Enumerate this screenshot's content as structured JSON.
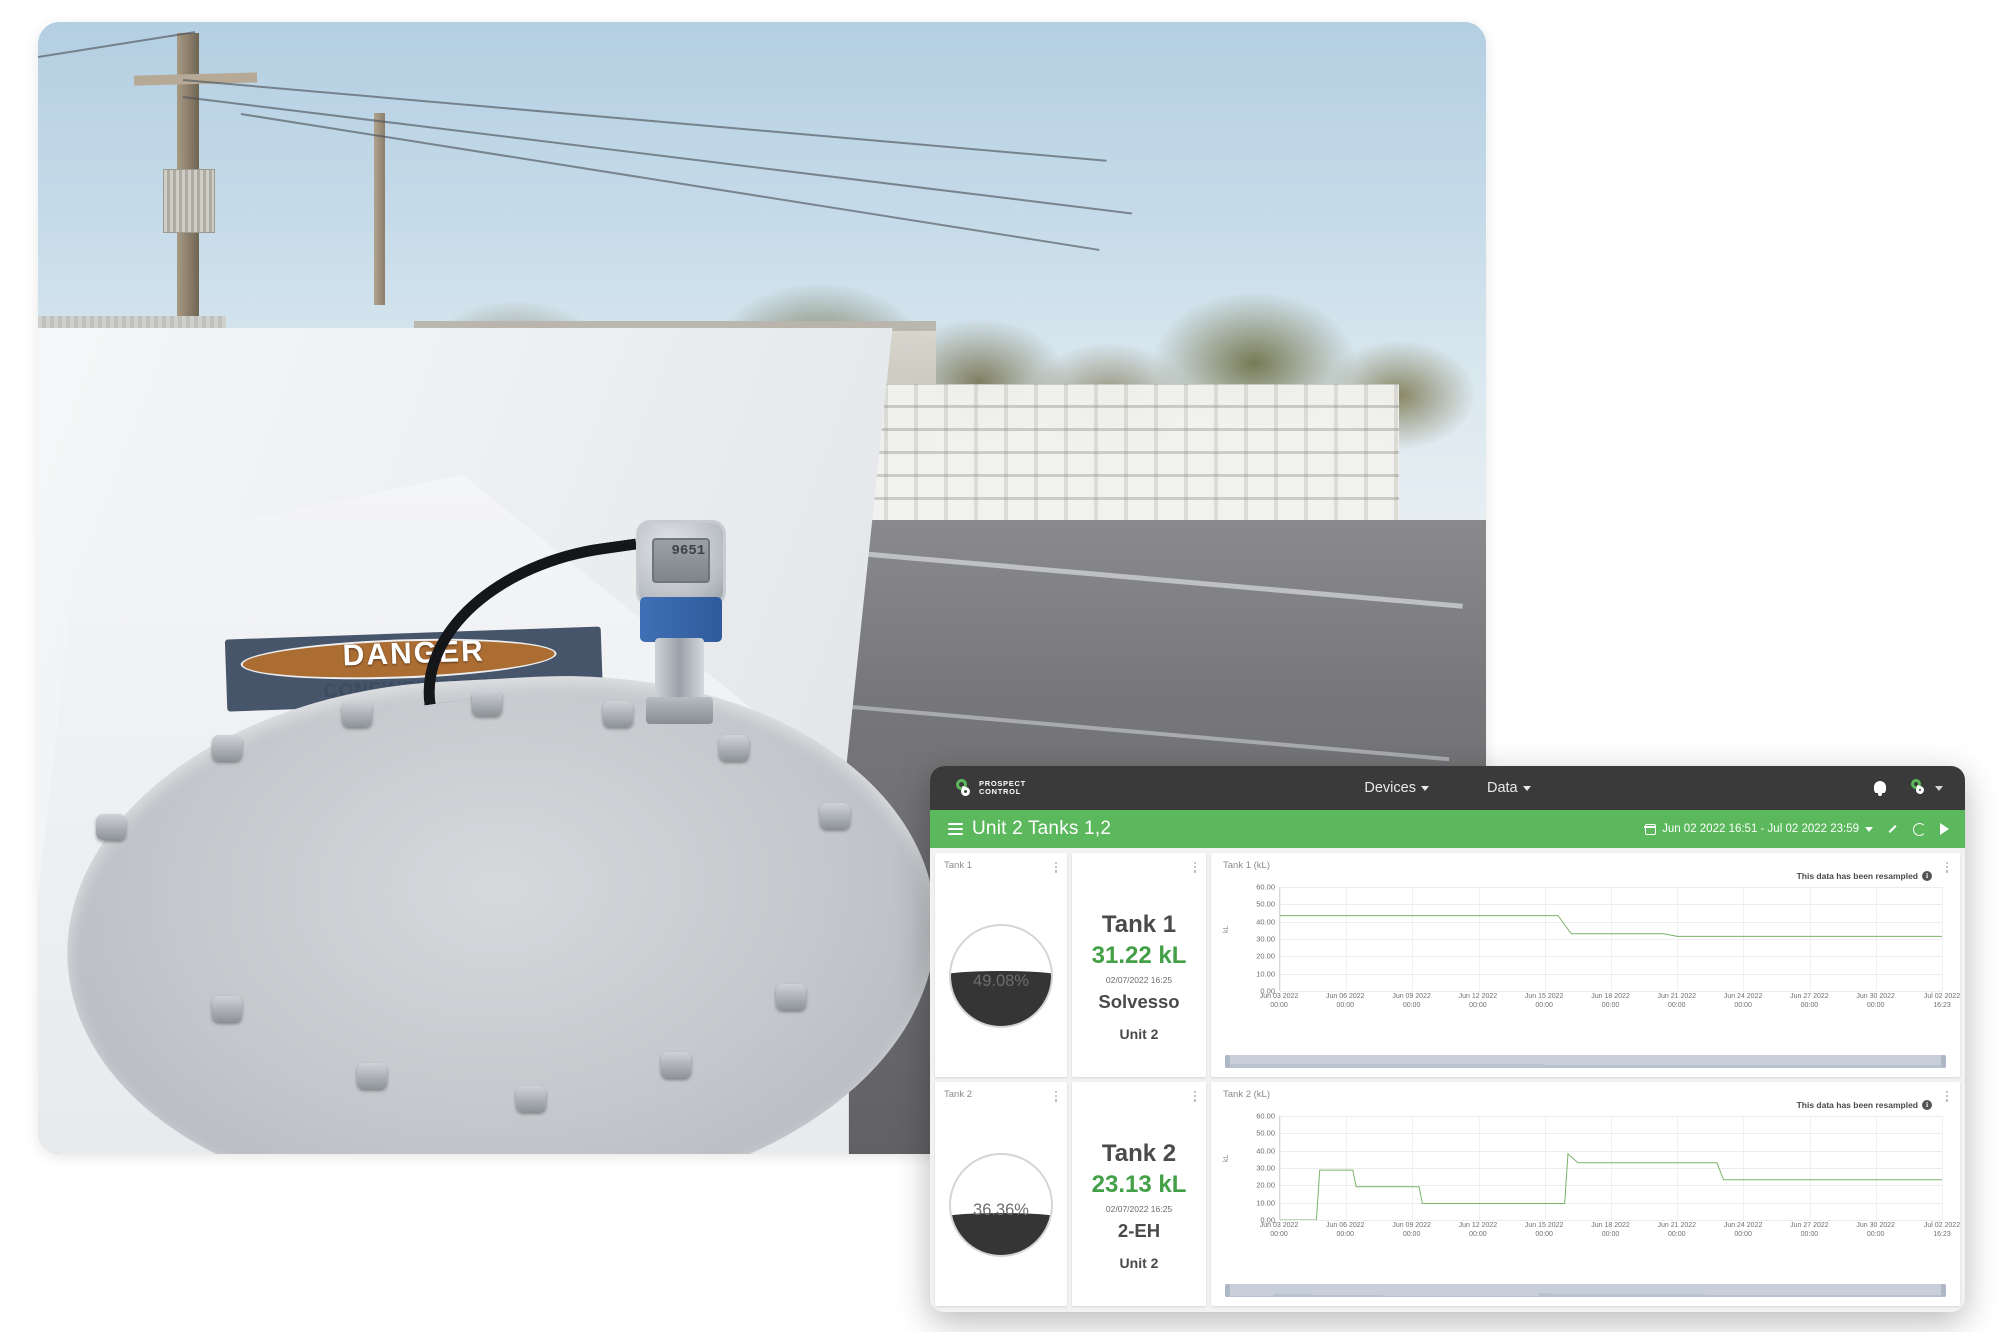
{
  "photo": {
    "alt": "Rooftop of a white road tanker with level transmitter, industrial yard with IBC totes behind",
    "decal_main": "DANGER",
    "decal_sub": "CONFINED SPACE",
    "sensor_display": "9651"
  },
  "nav": {
    "logo_line1": "PROSPECT",
    "logo_line2": "CONTROL",
    "items": [
      {
        "label": "Devices",
        "name": "nav-devices"
      },
      {
        "label": "Data",
        "name": "nav-data"
      }
    ],
    "bell_icon": "bell-icon",
    "avatar_icon": "user-avatar-icon"
  },
  "subheader": {
    "menu_icon": "hamburger-icon",
    "title": "Unit 2 Tanks 1,2",
    "calendar_icon": "calendar-icon",
    "date_range": "Jun 02 2022 16:51 - Jul 02 2022 23:59",
    "expand_icon": "expand-icon",
    "refresh_icon": "refresh-icon",
    "play_icon": "play-icon"
  },
  "colors": {
    "brand_green": "#5cb85c",
    "value_green": "#43a047",
    "nav_dark": "#3a3a3a",
    "gauge_fill": "#353535",
    "line_green": "#7cb36a"
  },
  "cards": {
    "gauges": [
      {
        "title": "Tank 1",
        "percent_label": "49.08%",
        "percent": 49.08
      },
      {
        "title": "Tank 2",
        "percent_label": "36.36%",
        "percent": 36.36
      }
    ],
    "values": [
      {
        "title": "",
        "name": "Tank 1",
        "amount": "31.22 kL",
        "timestamp": "02/07/2022 16:25",
        "product": "Solvesso",
        "unit": "Unit 2"
      },
      {
        "title": "",
        "name": "Tank 2",
        "amount": "23.13 kL",
        "timestamp": "02/07/2022 16:25",
        "product": "2-EH",
        "unit": "Unit 2"
      }
    ],
    "charts": [
      {
        "title": "Tank 1 (kL)",
        "notice": "This data has been resampled",
        "info_icon": "info-icon"
      },
      {
        "title": "Tank 2 (kL)",
        "notice": "This data has been resampled",
        "info_icon": "info-icon"
      }
    ]
  },
  "chart_data": [
    {
      "type": "line",
      "title": "Tank 1 (kL)",
      "xlabel": "",
      "ylabel": "kL",
      "ylim": [
        0,
        60
      ],
      "yticks": [
        "0.00",
        "10.00",
        "20.00",
        "30.00",
        "40.00",
        "50.00",
        "60.00"
      ],
      "grid": true,
      "legend": "none",
      "xtick_labels": [
        "Jun 03 2022",
        "Jun 06 2022",
        "Jun 09 2022",
        "Jun 12 2022",
        "Jun 15 2022",
        "Jun 18 2022",
        "Jun 21 2022",
        "Jun 24 2022",
        "Jun 27 2022",
        "Jun 30 2022",
        "Jul 02 2022"
      ],
      "xtick_times": [
        "00:00",
        "00:00",
        "00:00",
        "00:00",
        "00:00",
        "00:00",
        "00:00",
        "00:00",
        "00:00",
        "00:00",
        "16:23"
      ],
      "series": [
        {
          "name": "Tank 1",
          "color": "#7cb36a",
          "x": [
            0,
            42,
            44,
            58,
            60,
            100
          ],
          "values": [
            43.5,
            43.5,
            33.0,
            33.0,
            31.5,
            31.5
          ]
        }
      ]
    },
    {
      "type": "line",
      "title": "Tank 2 (kL)",
      "xlabel": "",
      "ylabel": "kL",
      "ylim": [
        0,
        60
      ],
      "yticks": [
        "0.00",
        "10.00",
        "20.00",
        "30.00",
        "40.00",
        "50.00",
        "60.00"
      ],
      "grid": true,
      "legend": "none",
      "xtick_labels": [
        "Jun 03 2022",
        "Jun 06 2022",
        "Jun 09 2022",
        "Jun 12 2022",
        "Jun 15 2022",
        "Jun 18 2022",
        "Jun 21 2022",
        "Jun 24 2022",
        "Jun 27 2022",
        "Jun 30 2022",
        "Jul 02 2022"
      ],
      "xtick_times": [
        "00:00",
        "00:00",
        "00:00",
        "00:00",
        "00:00",
        "00:00",
        "00:00",
        "00:00",
        "00:00",
        "00:00",
        "16:23"
      ],
      "series": [
        {
          "name": "Tank 2",
          "color": "#7cb36a",
          "x": [
            0,
            5.5,
            6,
            11,
            11.5,
            21,
            21.5,
            43,
            43.5,
            45,
            46,
            66,
            67,
            100
          ],
          "values": [
            0,
            0,
            28.8,
            28.8,
            19.2,
            19.2,
            9.5,
            9.5,
            38.2,
            33.0,
            33.0,
            33.0,
            23.2,
            23.2
          ]
        }
      ]
    }
  ]
}
